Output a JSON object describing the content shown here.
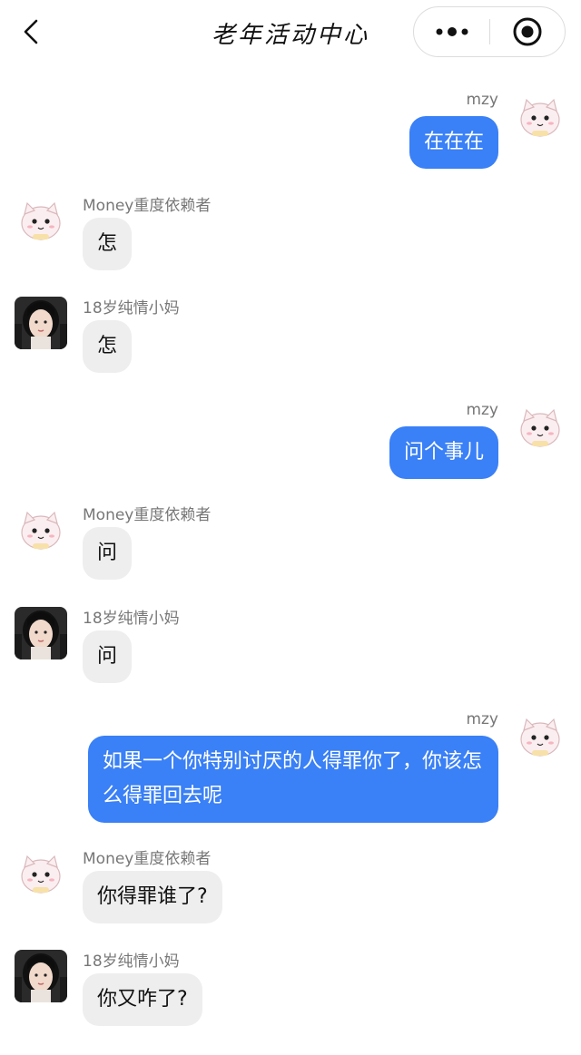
{
  "header": {
    "title": "老年活动中心",
    "back_icon": "chevron-left-icon",
    "more_icon": "more-dots-icon",
    "target_icon": "target-icon"
  },
  "colors": {
    "self_bubble": "#3a80f6",
    "other_bubble": "#eeeeee",
    "sender_text": "#777777"
  },
  "messages": [
    {
      "side": "right",
      "sender": "mzy",
      "text": "在在在",
      "avatar_icon": "cat-avatar-icon"
    },
    {
      "side": "left",
      "sender": "Money重度依赖者",
      "text": "怎",
      "avatar_icon": "cat-avatar-icon"
    },
    {
      "side": "left",
      "sender": "18岁纯情小妈",
      "text": "怎",
      "avatar_icon": "girl-avatar-icon"
    },
    {
      "side": "right",
      "sender": "mzy",
      "text": "问个事儿",
      "avatar_icon": "cat-avatar-icon"
    },
    {
      "side": "left",
      "sender": "Money重度依赖者",
      "text": "问",
      "avatar_icon": "cat-avatar-icon"
    },
    {
      "side": "left",
      "sender": "18岁纯情小妈",
      "text": "问",
      "avatar_icon": "girl-avatar-icon"
    },
    {
      "side": "right",
      "sender": "mzy",
      "text": "如果一个你特别讨厌的人得罪你了，你该怎么得罪回去呢",
      "avatar_icon": "cat-avatar-icon"
    },
    {
      "side": "left",
      "sender": "Money重度依赖者",
      "text": "你得罪谁了?",
      "avatar_icon": "cat-avatar-icon"
    },
    {
      "side": "left",
      "sender": "18岁纯情小妈",
      "text": "你又咋了?",
      "avatar_icon": "girl-avatar-icon"
    }
  ]
}
